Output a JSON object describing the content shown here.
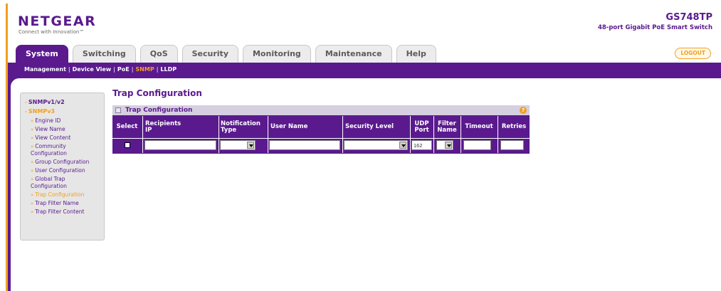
{
  "header": {
    "brand": "NETGEAR",
    "tagline": "Connect with Innovation™",
    "model": "GS748TP",
    "model_desc": "48-port Gigabit PoE Smart Switch"
  },
  "tabs": [
    {
      "label": "System",
      "active": true
    },
    {
      "label": "Switching",
      "active": false
    },
    {
      "label": "QoS",
      "active": false
    },
    {
      "label": "Security",
      "active": false
    },
    {
      "label": "Monitoring",
      "active": false
    },
    {
      "label": "Maintenance",
      "active": false
    },
    {
      "label": "Help",
      "active": false
    }
  ],
  "logout_label": "LOGOUT",
  "subnav": [
    {
      "label": "Management",
      "active": false
    },
    {
      "label": "Device View",
      "active": false
    },
    {
      "label": "PoE",
      "active": false
    },
    {
      "label": "SNMP",
      "active": true
    },
    {
      "label": "LLDP",
      "active": false
    }
  ],
  "leftnav": {
    "top1": "SNMPv1/v2",
    "top2": "SNMPv3",
    "items": [
      {
        "label": "Engine ID",
        "active": false
      },
      {
        "label": "View Name",
        "active": false
      },
      {
        "label": "View Content",
        "active": false
      },
      {
        "label": "Community Configuration",
        "active": false
      },
      {
        "label": "Group Configuration",
        "active": false
      },
      {
        "label": "User Configuration",
        "active": false
      },
      {
        "label": "Global Trap Configuration",
        "active": false
      },
      {
        "label": "Trap Configuration",
        "active": true
      },
      {
        "label": "Trap Filter Name",
        "active": false
      },
      {
        "label": "Trap Filter Content",
        "active": false
      }
    ]
  },
  "page_title": "Trap Configuration",
  "panel": {
    "title": "Trap Configuration",
    "help_icon": "?",
    "columns": {
      "select": "Select",
      "recipients_ip_1": "Recipients",
      "recipients_ip_2": "IP",
      "notification_type_1": "Notification",
      "notification_type_2": "Type",
      "user_name": "User Name",
      "security_level": "Security Level",
      "udp_port_1": "UDP",
      "udp_port_2": "Port",
      "filter_name_1": "Filter",
      "filter_name_2": "Name",
      "timeout": "Timeout",
      "retries": "Retries"
    },
    "row": {
      "recipients_ip": "",
      "notification_type": "",
      "user_name": "",
      "security_level": "",
      "udp_port": "162",
      "filter_name": "",
      "timeout": "",
      "retries": ""
    }
  }
}
